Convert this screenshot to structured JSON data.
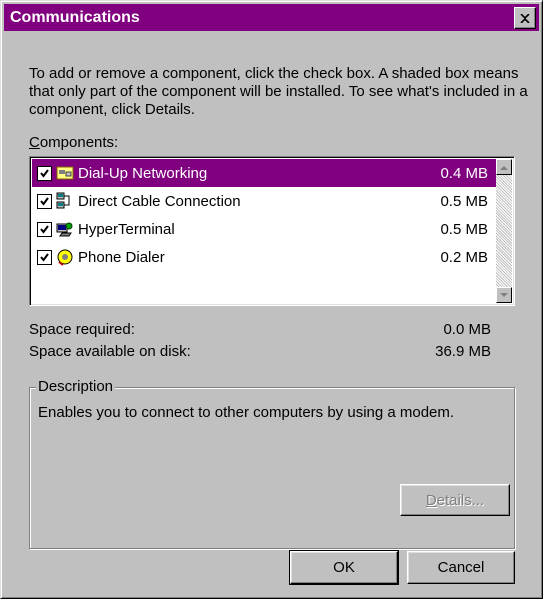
{
  "dialog": {
    "title": "Communications",
    "intro": "To add or remove a component, click the check box. A shaded box means that only part of the component will be installed. To see what's included in a component, click Details.",
    "components_label_accel": "C",
    "components_label_rest": "omponents:"
  },
  "components": [
    {
      "name": "Dial-Up Networking",
      "size": "0.4 MB",
      "checked": true,
      "selected": true,
      "icon": "dial-up-networking-icon"
    },
    {
      "name": "Direct Cable Connection",
      "size": "0.5 MB",
      "checked": true,
      "selected": false,
      "icon": "direct-cable-connection-icon"
    },
    {
      "name": "HyperTerminal",
      "size": "0.5 MB",
      "checked": true,
      "selected": false,
      "icon": "hyperterminal-icon"
    },
    {
      "name": "Phone Dialer",
      "size": "0.2 MB",
      "checked": true,
      "selected": false,
      "icon": "phone-dialer-icon"
    }
  ],
  "space": {
    "required_label": "Space required:",
    "required_value": "0.0 MB",
    "available_label": "Space available on disk:",
    "available_value": "36.9 MB"
  },
  "description": {
    "legend": "Description",
    "text": "Enables you to connect to other computers by using a modem."
  },
  "buttons": {
    "details_accel": "D",
    "details_rest": "etails...",
    "ok": "OK",
    "cancel": "Cancel"
  },
  "colors": {
    "titlebar": "#800080",
    "selection": "#800080",
    "face": "#c0c0c0"
  }
}
